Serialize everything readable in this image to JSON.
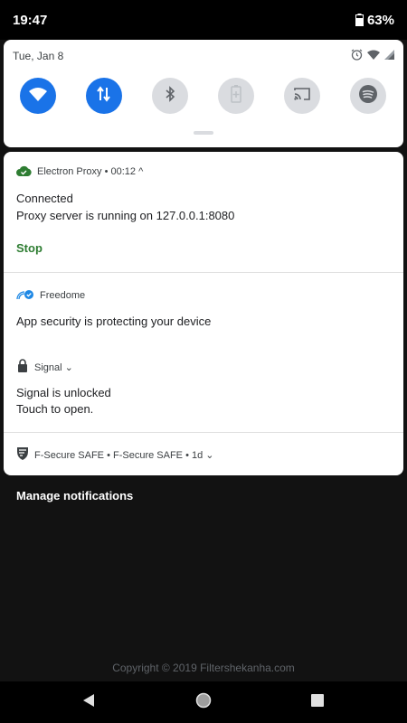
{
  "status_bar": {
    "time": "19:47",
    "battery": "63%"
  },
  "quick_settings": {
    "date": "Tue, Jan 8",
    "tiles": [
      {
        "icon": "wifi-icon",
        "state": "on"
      },
      {
        "icon": "mobile-data-icon",
        "state": "on"
      },
      {
        "icon": "bluetooth-icon",
        "state": "off"
      },
      {
        "icon": "battery-saver-icon",
        "state": "off"
      },
      {
        "icon": "cast-icon",
        "state": "off"
      },
      {
        "icon": "spotify-icon",
        "state": "off"
      }
    ]
  },
  "notifications": [
    {
      "app": "Electron Proxy • 00:12 ^",
      "title": "Connected",
      "text": "Proxy server is running on 127.0.0.1:8080",
      "action": "Stop"
    },
    {
      "app": "Freedome",
      "text": "App security is protecting your device"
    },
    {
      "app": "Signal ⌄",
      "title": "Signal is unlocked",
      "text": "Touch to open."
    },
    {
      "app": "F-Secure SAFE • F-Secure SAFE • 1d ⌄"
    }
  ],
  "manage_label": "Manage notifications",
  "copyright": "Copyright © 2019 Filtershekanha.com",
  "colors": {
    "accent": "#1a73e8",
    "action_green": "#2e7d32"
  }
}
